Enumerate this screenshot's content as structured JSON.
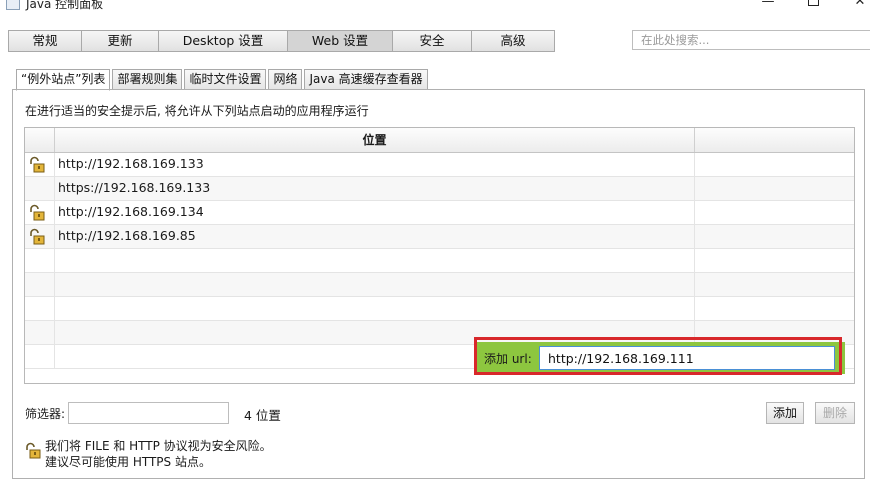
{
  "window": {
    "title": "Java 控制面板",
    "minimize": "—",
    "close": "✕"
  },
  "main_tabs": [
    {
      "label": "常规"
    },
    {
      "label": "更新"
    },
    {
      "label": "Desktop 设置"
    },
    {
      "label": "Web 设置"
    },
    {
      "label": "安全"
    },
    {
      "label": "高级"
    }
  ],
  "search": {
    "placeholder": "在此处搜索..."
  },
  "sub_tabs": [
    {
      "label": "“例外站点”列表"
    },
    {
      "label": "部署规则集"
    },
    {
      "label": "临时文件设置"
    },
    {
      "label": "网络"
    },
    {
      "label": "Java 高速缓存查看器"
    }
  ],
  "hint": "在进行适当的安全提示后, 将允许从下列站点启动的应用程序运行",
  "table": {
    "header": "位置",
    "rows": [
      {
        "url": "http://192.168.169.133",
        "icon": "lock-icon"
      },
      {
        "url": "https://192.168.169.133",
        "icon": ""
      },
      {
        "url": "http://192.168.169.134",
        "icon": "lock-icon"
      },
      {
        "url": "http://192.168.169.85",
        "icon": "lock-icon"
      }
    ]
  },
  "add_url": {
    "label": "添加 url:",
    "value": "http://192.168.169.111"
  },
  "filter": {
    "label": "筛选器:",
    "count": "4 位置"
  },
  "buttons": {
    "add": "添加",
    "delete": "删除"
  },
  "warning": {
    "line1": "我们将 FILE 和 HTTP 协议视为安全风险。",
    "line2": "建议尽可能使用 HTTPS 站点。"
  },
  "colors": {
    "highlight_bar": "#8dc63f",
    "annotation_box": "#d8282b",
    "input_focus": "#4a8fd6"
  }
}
